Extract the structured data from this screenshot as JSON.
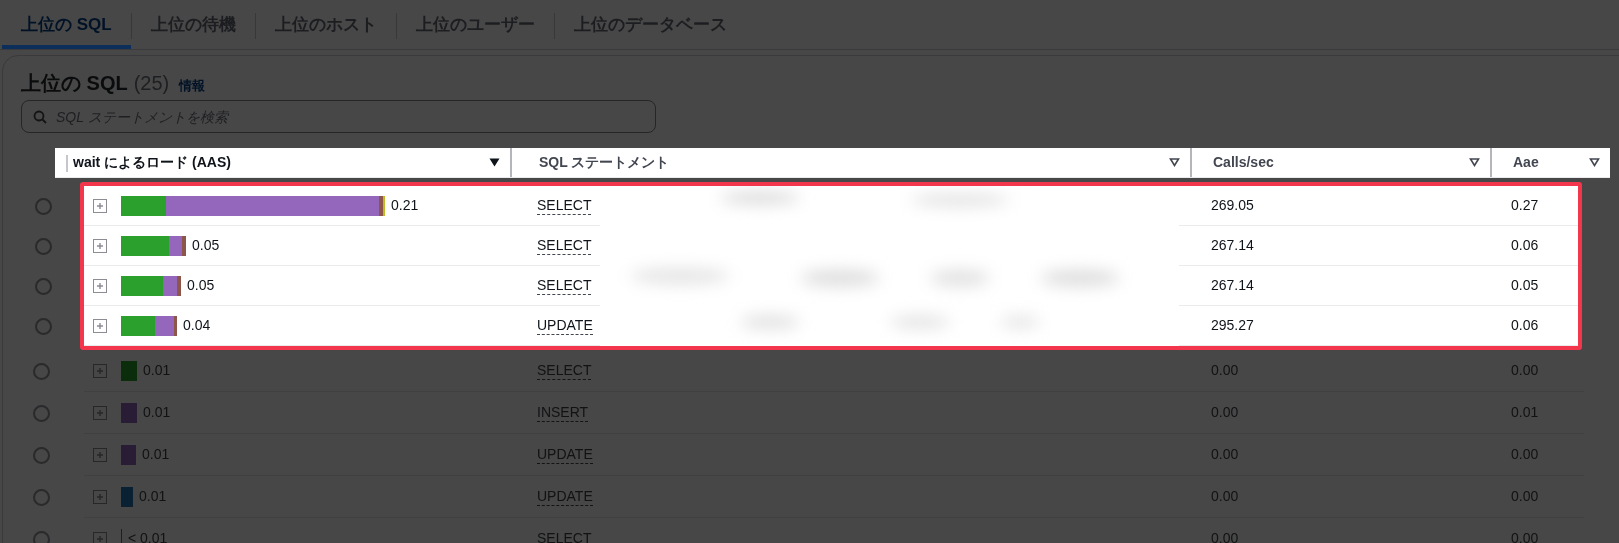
{
  "tabs": [
    {
      "label": "上位の SQL",
      "selected": true
    },
    {
      "label": "上位の待機",
      "selected": false
    },
    {
      "label": "上位のホスト",
      "selected": false
    },
    {
      "label": "上位のユーザー",
      "selected": false
    },
    {
      "label": "上位のデータベース",
      "selected": false
    }
  ],
  "panel": {
    "title": "上位の SQL",
    "count": "(25)",
    "info_link": "情報"
  },
  "search": {
    "placeholder": "SQL ステートメントを検索"
  },
  "table": {
    "columns": [
      {
        "label": "wait によるロード (AAS)",
        "sorted": true
      },
      {
        "label": "SQL ステートメント",
        "sorted": false
      },
      {
        "label": "Calls/sec",
        "sorted": false
      },
      {
        "label": "Aae",
        "sorted": false
      }
    ],
    "rows": [
      {
        "selected": false,
        "highlighted": true,
        "load": "0.21",
        "segments": [
          {
            "color": "#2ca02c"
          },
          {
            "color": "#9467bd"
          },
          {
            "color": "#8c564b"
          },
          {
            "color": "#bcbd22"
          }
        ],
        "sql": "SELECT",
        "calls": "269.05",
        "aae": "0.27"
      },
      {
        "selected": false,
        "highlighted": true,
        "load": "0.05",
        "segments": [
          {
            "color": "#2ca02c"
          },
          {
            "color": "#9467bd"
          },
          {
            "color": "#8c564b"
          }
        ],
        "sql": "SELECT",
        "calls": "267.14",
        "aae": "0.06"
      },
      {
        "selected": false,
        "highlighted": true,
        "load": "0.05",
        "segments": [
          {
            "color": "#2ca02c"
          },
          {
            "color": "#9467bd"
          },
          {
            "color": "#8c564b"
          }
        ],
        "sql": "SELECT",
        "calls": "267.14",
        "aae": "0.05"
      },
      {
        "selected": false,
        "highlighted": true,
        "load": "0.04",
        "segments": [
          {
            "color": "#2ca02c"
          },
          {
            "color": "#9467bd"
          },
          {
            "color": "#8c564b"
          }
        ],
        "sql": "UPDATE",
        "calls": "295.27",
        "aae": "0.06"
      },
      {
        "selected": false,
        "highlighted": false,
        "load": "0.01",
        "segments": [
          {
            "color": "#0c2d0c"
          }
        ],
        "sql": "SELECT",
        "calls": "0.00",
        "aae": "0.00"
      },
      {
        "selected": false,
        "highlighted": false,
        "load": "0.01",
        "segments": [
          {
            "color": "#291d35"
          }
        ],
        "sql": "INSERT",
        "calls": "0.00",
        "aae": "0.01"
      },
      {
        "selected": false,
        "highlighted": false,
        "load": "0.01",
        "segments": [
          {
            "color": "#291d35"
          }
        ],
        "sql": "UPDATE",
        "calls": "0.00",
        "aae": "0.00"
      },
      {
        "selected": false,
        "highlighted": false,
        "load": "0.01",
        "segments": [
          {
            "color": "#092132"
          }
        ],
        "sql": "UPDATE",
        "calls": "0.00",
        "aae": "0.00"
      },
      {
        "selected": false,
        "highlighted": false,
        "load": "< 0.01",
        "segments": [
          {
            "color": "#0c2d0c"
          }
        ],
        "sql": "SELECT",
        "calls": "0.00",
        "aae": "0.00"
      }
    ]
  }
}
